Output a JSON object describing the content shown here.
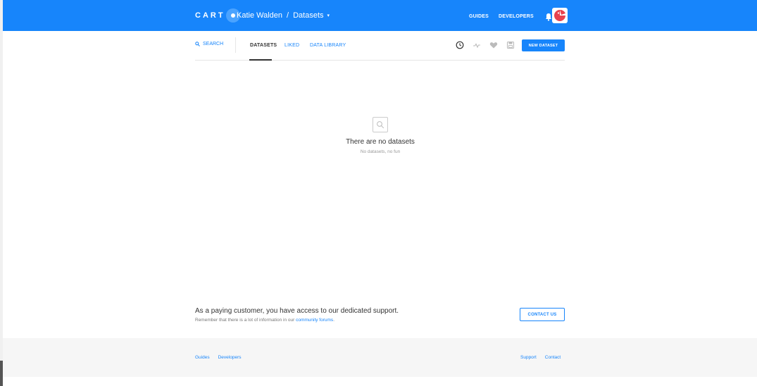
{
  "header": {
    "logo": "CART",
    "user": "Katie Walden",
    "separator": "/",
    "section": "Datasets",
    "links": [
      "GUIDES",
      "DEVELOPERS"
    ]
  },
  "subnav": {
    "search_label": "SEARCH",
    "tabs": [
      "DATASETS",
      "LIKED",
      "DATA LIBRARY"
    ],
    "active_tab": "DATASETS",
    "new_button": "NEW DATASET"
  },
  "empty_state": {
    "title": "There are no datasets",
    "subtitle": "No datasets, no fun"
  },
  "support": {
    "title": "As a paying customer, you have access to our dedicated support.",
    "text_before_link": "Remember that there is a lot of information in our",
    "link": "community forums",
    "text_after_link": ".",
    "contact_button": "CONTACT US"
  },
  "footer": {
    "left_links": [
      "Guides",
      "Developers"
    ],
    "right_links": [
      "Support",
      "Contact"
    ]
  },
  "colors": {
    "brand": "#1785fb",
    "avatar_accent": "#e8424f"
  },
  "icons": {
    "search": "search-icon",
    "bell": "bell-icon",
    "clock": "clock-icon",
    "activity": "activity-icon",
    "heart": "heart-icon",
    "save": "save-icon"
  }
}
